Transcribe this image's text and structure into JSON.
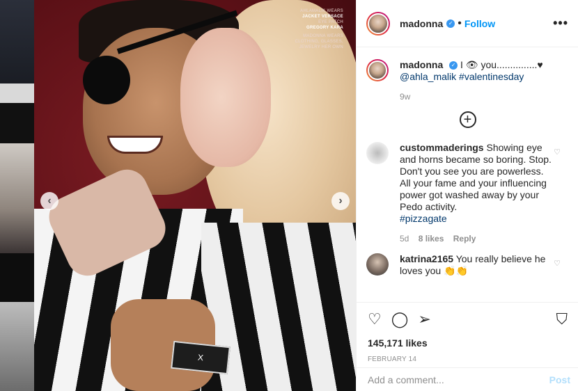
{
  "post": {
    "username": "madonna",
    "follow_label": "Follow",
    "dot": "•",
    "more_label": "•••",
    "caption_text": "I 👁 you...............♥",
    "caption_mention": "@ahla_malik",
    "caption_hashtag": "#valentinesday",
    "caption_age": "9w",
    "load_more_symbol": "+",
    "likes": "145,171 likes",
    "date": "FEBRUARY 14"
  },
  "photo": {
    "credits_line1": "AHLAMALIK WEARS",
    "credits_line2": "JACKET VERSACE",
    "credits_line3": "EYE PATCH",
    "credits_line4": "GREGORY KARA",
    "credits_line5": "MADONNA WEARS",
    "credits_line6": "CLOTHING, GLASSES,",
    "credits_line7": "JEWELRY HER OWN",
    "tag_text": "X",
    "prev_arrow": "‹",
    "next_arrow": "›"
  },
  "comments": [
    {
      "username": "custommaderings",
      "text": "Showing eye and horns became so boring. Stop. Don't you see you are powerless. All your fame and your influencing power got washed away by your Pedo activity.",
      "hashtag": "#pizzagate",
      "age": "5d",
      "likes": "8 likes",
      "reply": "Reply"
    },
    {
      "username": "katrina2165",
      "text": "You really believe he loves you 👏👏"
    }
  ],
  "add_comment": {
    "placeholder": "Add a comment...",
    "post_label": "Post"
  },
  "icons": {
    "heart": "♡",
    "comment": "◯",
    "share": "➢",
    "bookmark": "⛉"
  },
  "colors": {
    "accent": "#0095f6",
    "verified": "#3897f0",
    "muted": "#8e8e8e"
  }
}
